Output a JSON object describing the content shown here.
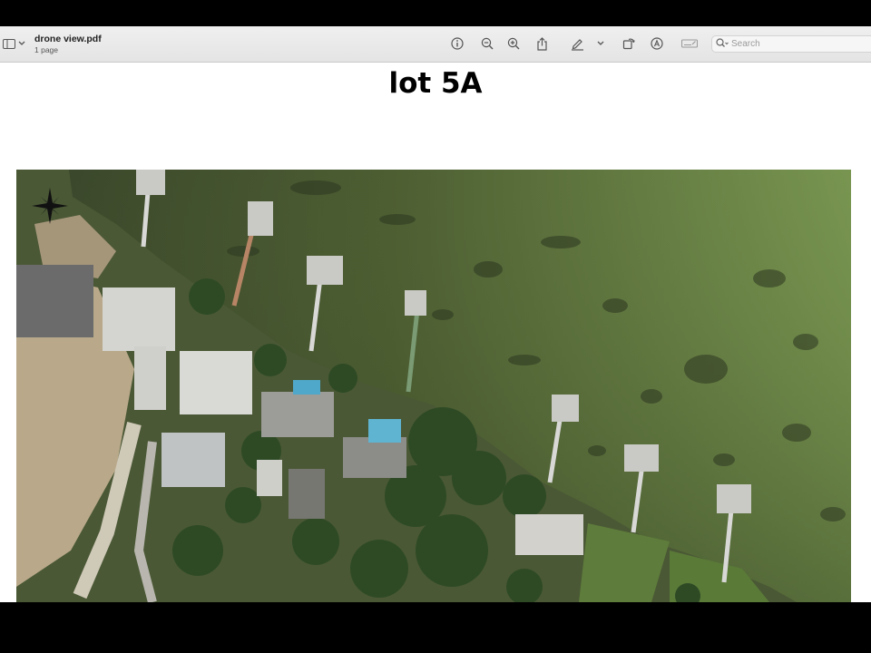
{
  "window": {
    "file_name": "drone view.pdf",
    "page_count": "1 page"
  },
  "toolbar": {
    "icons": [
      "sidebar-icon",
      "chevron-down-icon",
      "info-icon",
      "zoom-out-icon",
      "zoom-in-icon",
      "share-icon",
      "highlight-pen-icon",
      "chevron-down-icon",
      "rotate-icon",
      "markup-icon",
      "form-fill-icon",
      "search-icon"
    ],
    "search_placeholder": "Search"
  },
  "document": {
    "heading": "lot 5A",
    "image": "aerial photo of waterfront lots with docks",
    "colors": {
      "water_dark": "#3e4a2c",
      "water_light": "#6f8a48",
      "land": "#4d5a35",
      "trees": "#2f4d27"
    }
  }
}
